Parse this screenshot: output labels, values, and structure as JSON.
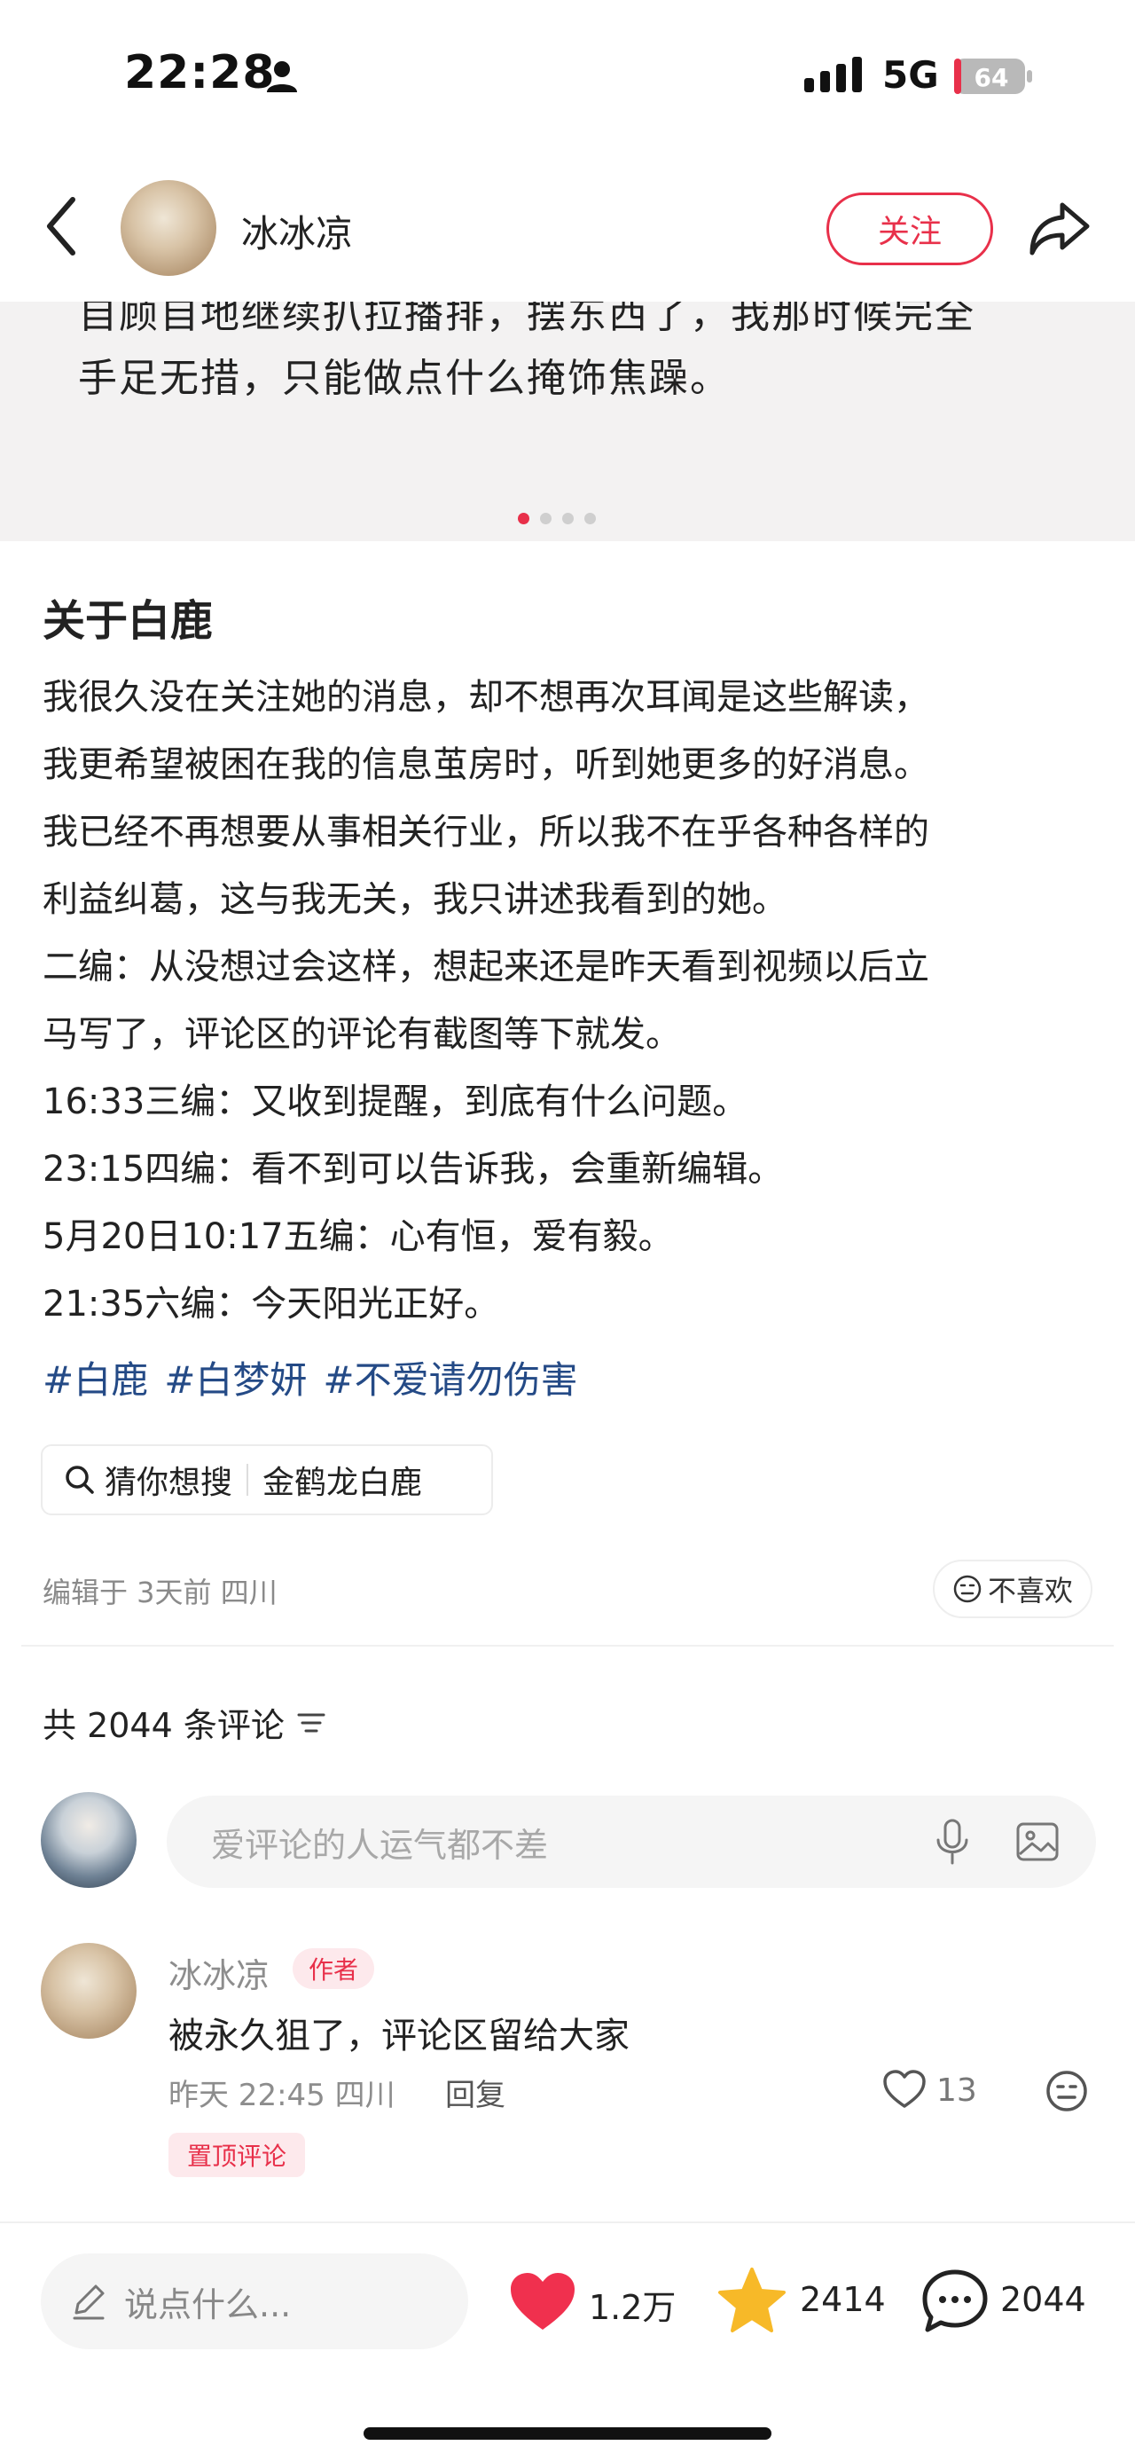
{
  "status_bar": {
    "time": "22:28",
    "network": "5G",
    "battery": "64"
  },
  "header": {
    "author_name": "冰冰凉",
    "follow_label": "关注"
  },
  "carousel": {
    "line1": "自顾自地继续扒拉播排，摆东西了，我那时候完全",
    "line2": "手足无措，只能做点什么掩饰焦躁。"
  },
  "post": {
    "title": "关于白鹿",
    "lines": [
      "我很久没在关注她的消息，却不想再次耳闻是这些解读，",
      "我更希望被困在我的信息茧房时，听到她更多的好消息。",
      "我已经不再想要从事相关行业，所以我不在乎各种各样的",
      "利益纠葛，这与我无关，我只讲述我看到的她。",
      "二编：从没想过会这样，想起来还是昨天看到视频以后立",
      "马写了，评论区的评论有截图等下就发。",
      "16:33三编：又收到提醒，到底有什么问题。",
      "23:15四编：看不到可以告诉我，会重新编辑。",
      "5月20日10:17五编：心有恒，爱有毅。",
      "21:35六编：今天阳光正好。"
    ],
    "tags": [
      "#白鹿",
      "#白梦妍",
      "#不爱请勿伤害"
    ],
    "search_chip": {
      "label": "猜你想搜",
      "query": "金鹤龙白鹿"
    },
    "edit_info": "编辑于 3天前 四川",
    "dislike_label": "不喜欢"
  },
  "comments": {
    "count_label": "共 2044 条评论",
    "input_placeholder": "爱评论的人运气都不差",
    "items": [
      {
        "name": "冰冰凉",
        "badge": "作者",
        "text": "被永久狙了，评论区留给大家",
        "meta": "昨天 22:45 四川",
        "reply_label": "回复",
        "likes": "13",
        "pinned_label": "置顶评论"
      }
    ]
  },
  "bottom_bar": {
    "input_placeholder": "说点什么...",
    "likes": "1.2万",
    "collects": "2414",
    "comments": "2044"
  },
  "colors": {
    "accent": "#e8304a",
    "tag": "#244a86",
    "star": "#f7b928"
  }
}
